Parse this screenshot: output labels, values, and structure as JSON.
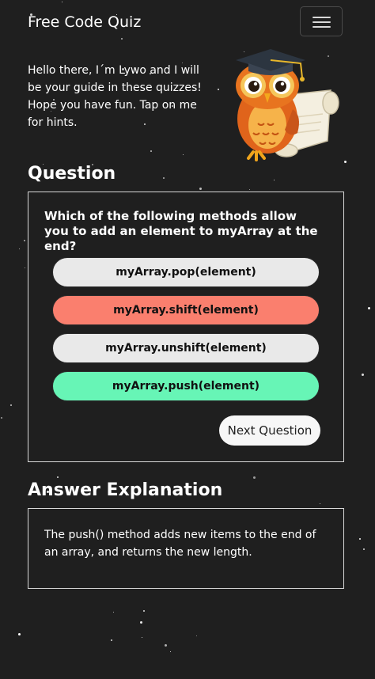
{
  "navbar": {
    "brand": "Free Code Quiz",
    "menu_icon": "hamburger-menu-icon"
  },
  "guide": {
    "intro": "Hello there, I´m Lywo and I will be your guide in these quizzes! Hope you have fun. Tap on me for hints.",
    "mascot_icon": "owl-graduate-mascot"
  },
  "question": {
    "heading": "Question",
    "text": "Which of the following methods allow you to add an element to myArray at the end?",
    "options": [
      {
        "label": "myArray.pop(element)",
        "state": "neutral",
        "color": "#e9e9e9"
      },
      {
        "label": "myArray.shift(element)",
        "state": "wrong",
        "color": "#fa7f6e"
      },
      {
        "label": "myArray.unshift(element)",
        "state": "neutral",
        "color": "#e9e9e9"
      },
      {
        "label": "myArray.push(element)",
        "state": "correct",
        "color": "#67f5b6"
      }
    ],
    "next_label": "Next Question"
  },
  "explanation": {
    "heading": "Answer Explanation",
    "text": "The push() method adds new items to the end of an array, and returns the new length."
  }
}
